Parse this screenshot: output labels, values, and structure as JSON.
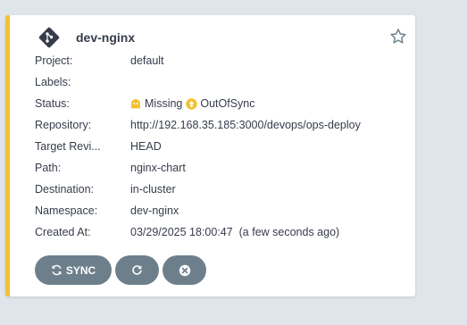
{
  "app": {
    "name": "dev-nginx",
    "accent_color": "#f4c030",
    "icon": "argo-git-diamond-icon",
    "favorite_icon": "star-outline-icon"
  },
  "fields": [
    {
      "key": "project",
      "label": "Project:",
      "value": "default"
    },
    {
      "key": "labels",
      "label": "Labels:",
      "value": ""
    },
    {
      "key": "status",
      "label": "Status:",
      "health": "Missing",
      "sync": "OutOfSync",
      "health_color": "#f4c030",
      "sync_color": "#f4c030"
    },
    {
      "key": "repository",
      "label": "Repository:",
      "value": "http://192.168.35.185:3000/devops/ops-deploy"
    },
    {
      "key": "target_revision",
      "label": "Target Revi...",
      "value": "HEAD"
    },
    {
      "key": "path",
      "label": "Path:",
      "value": "nginx-chart"
    },
    {
      "key": "destination",
      "label": "Destination:",
      "value": "in-cluster"
    },
    {
      "key": "namespace",
      "label": "Namespace:",
      "value": "dev-nginx"
    },
    {
      "key": "created_at",
      "label": "Created At:",
      "value": "03/29/2025 18:00:47  (a few seconds ago)"
    }
  ],
  "actions": {
    "sync_label": "SYNC",
    "refresh_icon": "refresh-icon",
    "delete_icon": "delete-circle-icon",
    "button_color": "#6d7f8b"
  }
}
